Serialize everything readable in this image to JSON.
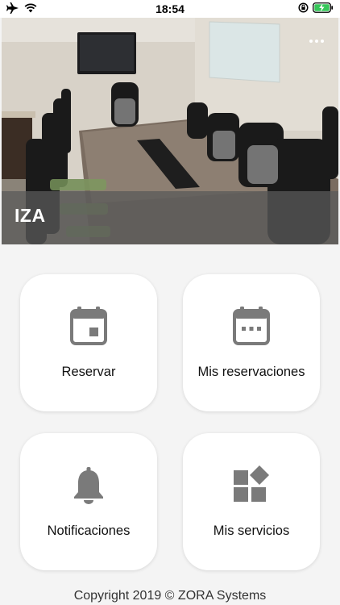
{
  "status_bar": {
    "time": "18:54",
    "icons": [
      "airplane-icon",
      "wifi-icon",
      "rotation-lock-icon",
      "battery-charging-icon"
    ]
  },
  "hero": {
    "title": "IZA",
    "menu_icon": "more-dots-icon"
  },
  "tiles": [
    {
      "label": "Reservar",
      "icon": "calendar-today-icon"
    },
    {
      "label": "Mis reservaciones",
      "icon": "calendar-list-icon"
    },
    {
      "label": "Notificaciones",
      "icon": "bell-icon"
    },
    {
      "label": "Mis servicios",
      "icon": "widgets-icon"
    }
  ],
  "footer": {
    "copyright": "Copyright 2019 © ZORA Systems"
  },
  "colors": {
    "icon_gray": "#7a7a7a",
    "tile_bg": "#ffffff",
    "page_bg": "#f4f4f4",
    "battery_green": "#35c759"
  }
}
